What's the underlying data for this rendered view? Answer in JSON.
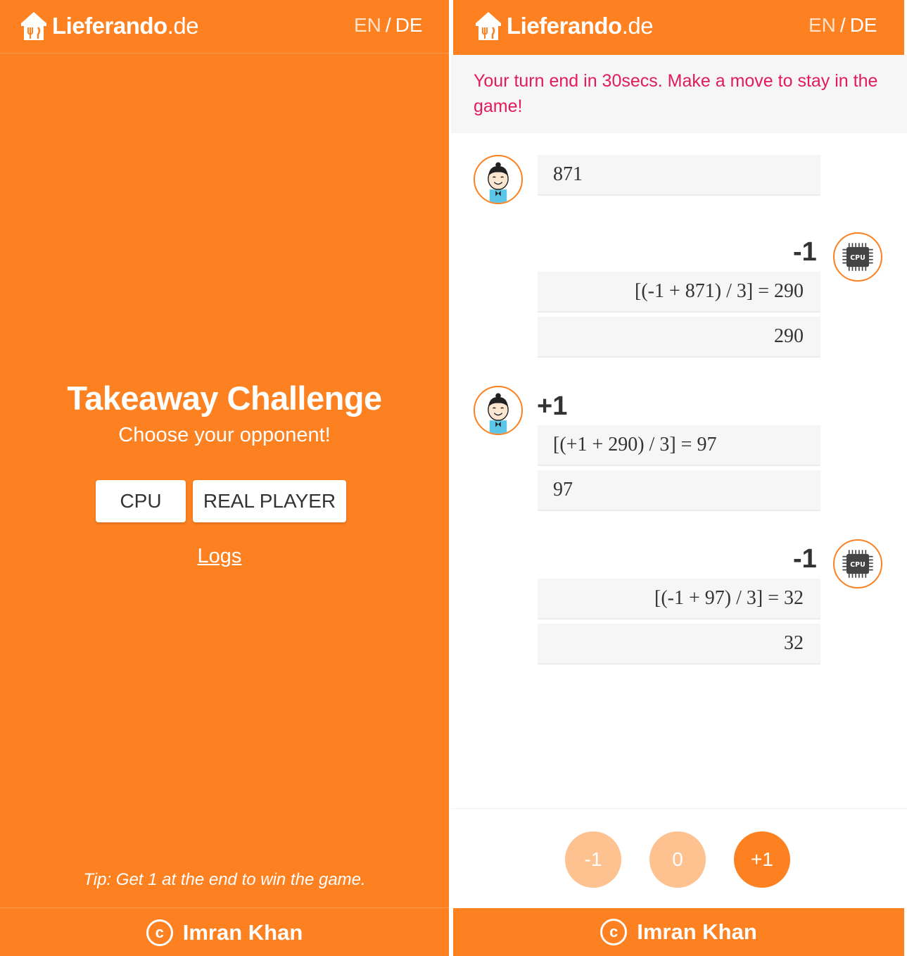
{
  "brand": {
    "name": "Lieferando",
    "tld": ".de"
  },
  "lang": {
    "en": "EN",
    "sep": "/",
    "de": "DE"
  },
  "start": {
    "title": "Takeaway Challenge",
    "subtitle": "Choose your opponent!",
    "cpu_label": "CPU",
    "real_player_label": "REAL PLAYER",
    "logs_label": "Logs",
    "tip": "Tip: Get 1 at the end to win the game."
  },
  "footer": {
    "copyright_symbol": "c",
    "author": "Imran Khan"
  },
  "game": {
    "warning": "Your turn end in 30secs. Make a move to stay in the game!",
    "turns": [
      {
        "player": "human",
        "value": "871"
      },
      {
        "player": "cpu",
        "move": "-1",
        "equation": "[(-1 + 871) / 3] = 290",
        "result": "290"
      },
      {
        "player": "human",
        "move": "+1",
        "equation": "[(+1 + 290) / 3] = 97",
        "result": "97"
      },
      {
        "player": "cpu",
        "move": "-1",
        "equation": "[(-1 + 97) / 3] = 32",
        "result": "32"
      }
    ],
    "controls": [
      {
        "label": "-1",
        "state": "disabled"
      },
      {
        "label": "0",
        "state": "disabled"
      },
      {
        "label": "+1",
        "state": "active"
      }
    ],
    "cpu_chip_label": "CPU"
  },
  "colors": {
    "orange": "#fd8021",
    "orange_light": "#fec190",
    "warning": "#e21b5a",
    "box_bg": "#f6f6f6"
  }
}
